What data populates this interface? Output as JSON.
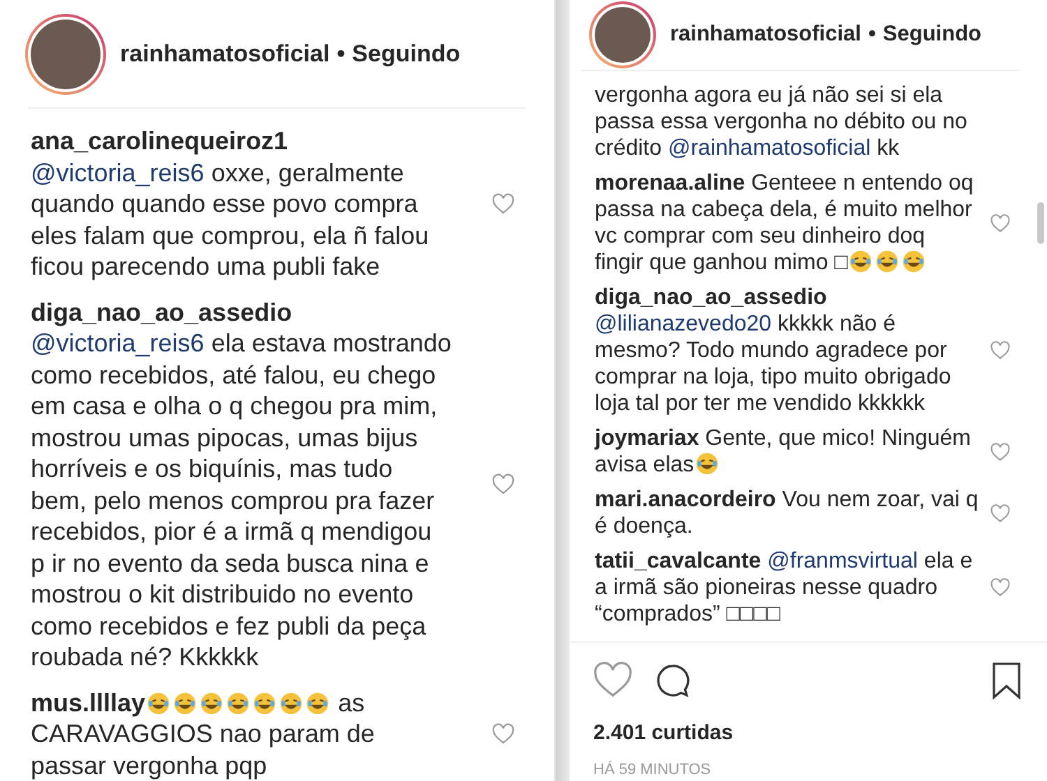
{
  "left_post": {
    "header": {
      "username": "rainhamatosoficial",
      "separator": "•",
      "follow_status": "Seguindo"
    },
    "comments": [
      {
        "user": "ana_carolinequeiroz1",
        "parts": [
          {
            "kind": "mention",
            "text": "@victoria_reis6"
          },
          {
            "kind": "text",
            "text": "oxxe, geralmente quando quando esse povo compra eles falam que comprou, ela ñ falou ficou parecendo uma publi fake"
          }
        ]
      },
      {
        "user": "diga_nao_ao_assedio",
        "parts": [
          {
            "kind": "mention",
            "text": "@victoria_reis6"
          },
          {
            "kind": "text",
            "text": "ela estava mostrando como recebidos, até falou, eu chego em casa e olha o q chegou pra mim, mostrou umas pipocas, umas bijus horríveis e os biquínis, mas tudo bem, pelo menos comprou pra fazer recebidos, pior é a irmã q mendigou p ir no evento da seda busca nina e mostrou o kit distribuido no evento como recebidos e fez publi da peça roubada né? Kkkkkk"
          }
        ]
      },
      {
        "user": "mus.llllay",
        "parts": [
          {
            "kind": "emoji"
          },
          {
            "kind": "emoji"
          },
          {
            "kind": "emoji"
          },
          {
            "kind": "emoji"
          },
          {
            "kind": "emoji"
          },
          {
            "kind": "emoji"
          },
          {
            "kind": "emoji"
          },
          {
            "kind": "text",
            "text": "as CARAVAGGIOS nao param de passar vergonha pqp"
          }
        ]
      }
    ]
  },
  "right_post": {
    "header": {
      "username": "rainhamatosoficial",
      "separator": "•",
      "follow_status": "Seguindo"
    },
    "partial_comment": {
      "parts": [
        {
          "kind": "text",
          "text": "vergonha agora eu já não sei si ela passa essa vergonha no débito ou no crédito"
        },
        {
          "kind": "mention",
          "text": "@rainhamatosoficial"
        },
        {
          "kind": "text",
          "text": "kk"
        }
      ]
    },
    "comments": [
      {
        "user": "morenaa.aline",
        "parts": [
          {
            "kind": "text",
            "text": "Genteee n entendo oq passa na cabeça dela, é muito melhor vc comprar com seu dinheiro doq fingir que ganhou mimo □"
          },
          {
            "kind": "emoji"
          },
          {
            "kind": "emoji"
          },
          {
            "kind": "emoji"
          }
        ]
      },
      {
        "user": "diga_nao_ao_assedio",
        "parts": [
          {
            "kind": "mention",
            "text": "@lilianazevedo20"
          },
          {
            "kind": "text",
            "text": "kkkkk não é mesmo? Todo mundo agradece por comprar na loja, tipo muito obrigado loja tal por ter me vendido kkkkkk"
          }
        ]
      },
      {
        "user": "joymariax",
        "parts": [
          {
            "kind": "text",
            "text": "Gente, que mico! Ninguém avisa elas"
          },
          {
            "kind": "emoji"
          }
        ]
      },
      {
        "user": "mari.anacordeiro",
        "parts": [
          {
            "kind": "text",
            "text": "Vou nem zoar, vai q é doença."
          }
        ]
      },
      {
        "user": "tatii_cavalcante",
        "parts": [
          {
            "kind": "mention",
            "text": "@franmsvirtual"
          },
          {
            "kind": "text",
            "text": "ela e a irmã são pioneiras nesse quadro “comprados” □□□□"
          }
        ]
      }
    ],
    "likes": "2.401 curtidas",
    "time": "HÁ 59 MINUTOS"
  }
}
